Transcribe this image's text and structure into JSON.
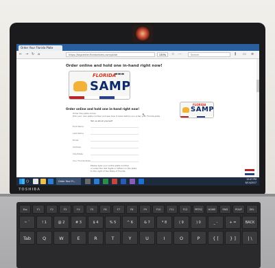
{
  "browser": {
    "tab_title": "Order Your Florida Plate",
    "address": "https://tagcenter.floridahsmv.com/plate",
    "zoom": "133%",
    "search_placeholder": "Search"
  },
  "page": {
    "headline": "Order online and hold one in-hand right now!",
    "section_heading": "Order online and hold one in-hand right now!",
    "intro_line_1": "Order this plate online",
    "intro_line_2": "Pick your own plate number and see how it looks before you order your Florida plate",
    "form_heading": "Tell us about yourself",
    "fields": [
      "First Name",
      "Last Name",
      "Email",
      "Address",
      "City/State",
      "Your Florida Plate"
    ],
    "note_lines": [
      "Please type your entire plate number",
      "or enter the last digits or letters on the plate",
      "to the right of the State of Florida"
    ],
    "large_plate": {
      "state": "FLORIDA",
      "code": "SAMPL",
      "top_right": "▬▬▬"
    },
    "small_plate": {
      "state": "FLORIDA",
      "code": "SAMPL"
    }
  },
  "taskbar": {
    "active_item": "Order Your Fl...",
    "time": "12:47 PM",
    "date": "8/14/2017"
  },
  "laptop": {
    "brand": "TOSHIBA"
  },
  "keyboard": {
    "fn_row": [
      "Esc",
      "F1",
      "F2",
      "F3",
      "F4",
      "F5",
      "F6",
      "F7",
      "F8",
      "F9",
      "F10",
      "F11",
      "F12",
      "PRTSC",
      "HOME",
      "END",
      "PGUP",
      "DEL"
    ],
    "num_row": [
      "~ `",
      "! 1",
      "@ 2",
      "# 3",
      "$ 4",
      "% 5",
      "^ 6",
      "& 7",
      "* 8",
      "( 9",
      ") 0",
      "_ -",
      "+ =",
      "BACK SPACE"
    ],
    "qwerty_row": [
      "Tab",
      "Q",
      "W",
      "E",
      "R",
      "T",
      "Y",
      "U",
      "I",
      "O",
      "P",
      "{ [",
      "} ]",
      "| \\"
    ]
  }
}
